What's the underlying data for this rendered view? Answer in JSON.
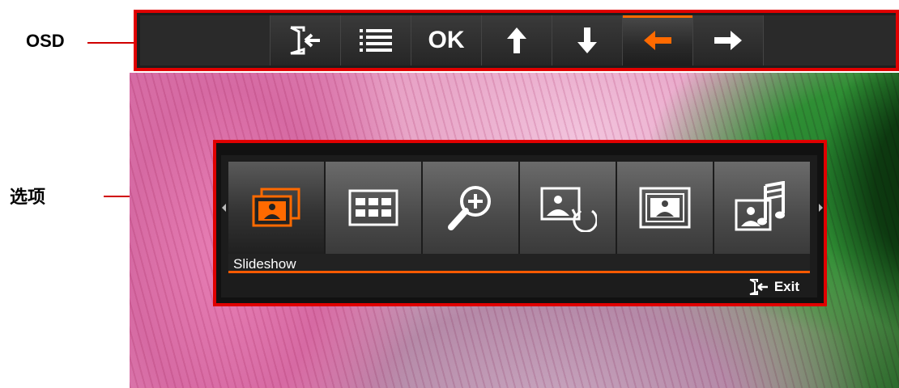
{
  "annotations": {
    "osd_label": "OSD",
    "options_label": "选项"
  },
  "osd": {
    "buttons": [
      {
        "icon": "exit-icon",
        "label": ""
      },
      {
        "icon": "list-icon",
        "label": ""
      },
      {
        "icon": "ok",
        "label": "OK"
      },
      {
        "icon": "arrow-up-icon",
        "label": ""
      },
      {
        "icon": "arrow-down-icon",
        "label": ""
      },
      {
        "icon": "arrow-left-icon",
        "label": "",
        "active": true
      },
      {
        "icon": "arrow-right-icon",
        "label": ""
      }
    ],
    "accent_color": "#ff6a00"
  },
  "options": {
    "items": [
      {
        "icon": "slideshow-icon",
        "selected": true
      },
      {
        "icon": "thumbnail-grid-icon"
      },
      {
        "icon": "zoom-in-icon"
      },
      {
        "icon": "rotate-image-icon"
      },
      {
        "icon": "photo-frame-icon"
      },
      {
        "icon": "music-slideshow-icon"
      }
    ],
    "caption": "Slideshow",
    "exit_label": "Exit"
  }
}
